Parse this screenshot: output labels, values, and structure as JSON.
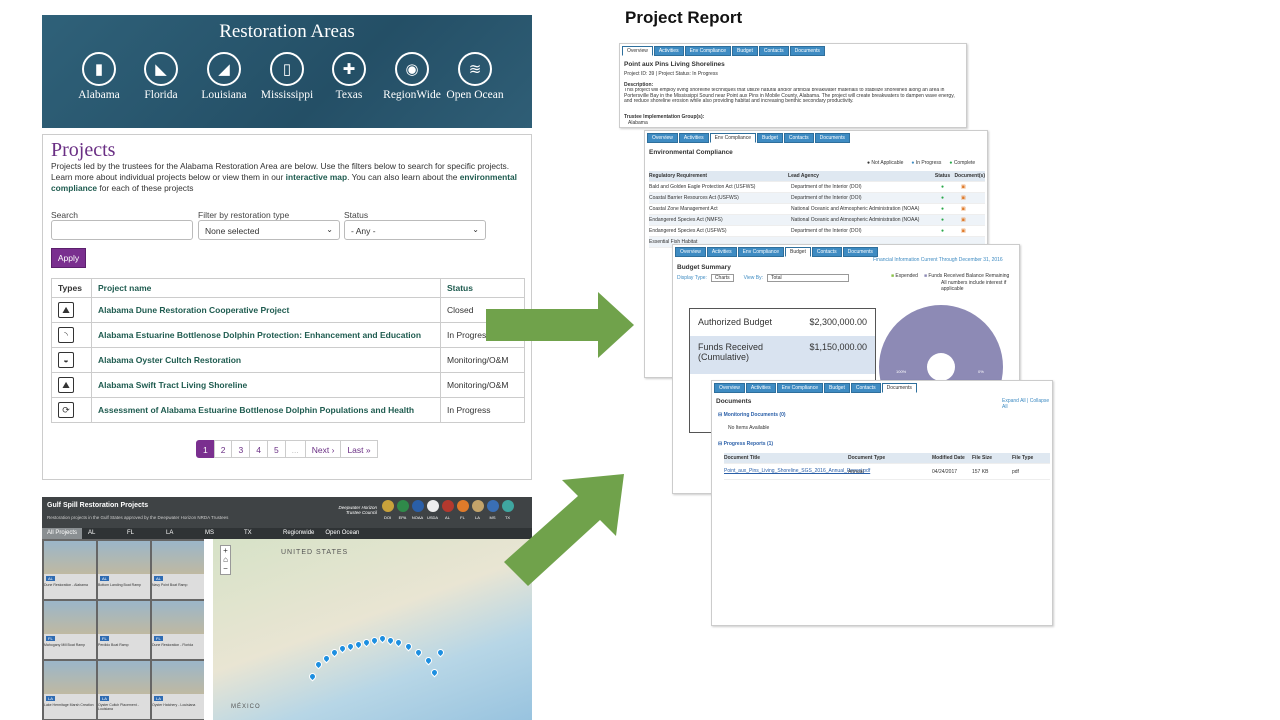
{
  "restoration_areas": {
    "title": "Restoration Areas",
    "areas": [
      {
        "label": "Alabama",
        "icon": "alabama-state-icon"
      },
      {
        "label": "Florida",
        "icon": "florida-state-icon"
      },
      {
        "label": "Louisiana",
        "icon": "louisiana-state-icon"
      },
      {
        "label": "Mississippi",
        "icon": "mississippi-state-icon"
      },
      {
        "label": "Texas",
        "icon": "texas-state-icon"
      },
      {
        "label": "RegionWide",
        "icon": "region-wide-icon"
      },
      {
        "label": "Open Ocean",
        "icon": "open-ocean-icon"
      }
    ]
  },
  "projects": {
    "title": "Projects",
    "desc_1": "Projects led by the trustees for the Alabama Restoration Area are below. Use the filters below to search for specific projects. Learn more about individual projects below or view them in our ",
    "link_map": "interactive map",
    "desc_2": ". You can also learn about the ",
    "link_env": "environmental compliance",
    "desc_3": " for each of these projects",
    "search_label": "Search",
    "search_value": "",
    "type_label": "Filter by restoration type",
    "type_value": "None selected",
    "status_label": "Status",
    "status_value": "- Any -",
    "apply": "Apply",
    "columns": {
      "types": "Types",
      "name": "Project name",
      "status": "Status"
    },
    "rows": [
      {
        "icon": "dune-restoration-icon",
        "name": "Alabama Dune Restoration Cooperative Project",
        "status": "Closed"
      },
      {
        "icon": "dolphin-icon",
        "name": "Alabama Estuarine Bottlenose Dolphin Protection: Enhancement and Education",
        "status": "In Progress"
      },
      {
        "icon": "oyster-icon",
        "name": "Alabama Oyster Cultch Restoration",
        "status": "Monitoring/O&M"
      },
      {
        "icon": "shoreline-icon",
        "name": "Alabama Swift Tract Living Shoreline",
        "status": "Monitoring/O&M"
      },
      {
        "icon": "assessment-icon",
        "name": "Assessment of Alabama Estuarine Bottlenose Dolphin Populations and Health",
        "status": "In Progress"
      }
    ],
    "pager": [
      "1",
      "2",
      "3",
      "4",
      "5",
      "...",
      "Next ›",
      "Last »"
    ]
  },
  "map_app": {
    "title": "Gulf Spill Restoration Projects",
    "subtitle": "Restoration projects in the Gulf States approved by the Deepwater Horizon NRDA Trustees",
    "council": "Deepwater Horizon Trustee Council",
    "agencies": [
      "DOI",
      "EPA",
      "NOAA",
      "USDA",
      "AL",
      "FL",
      "LA",
      "MS",
      "TX"
    ],
    "tabs": [
      "All Projects",
      "AL",
      "FL",
      "LA",
      "MS",
      "TX",
      "Regionwide",
      "Open Ocean"
    ],
    "thumbs": [
      {
        "tag": "AL",
        "label": "Dune Restoration - Alabama"
      },
      {
        "tag": "AL",
        "label": "Bottom Landing Boat Ramp"
      },
      {
        "tag": "AL",
        "label": "Navy Point Boat Ramp"
      },
      {
        "tag": "FL",
        "label": "Mahogany Mill Boat Ramp"
      },
      {
        "tag": "FL",
        "label": "Perdido Boat Ramp"
      },
      {
        "tag": "FL",
        "label": "Dune Restoration - Florida"
      },
      {
        "tag": "LA",
        "label": "Lake Hermitage Marsh Creation"
      },
      {
        "tag": "LA",
        "label": "Oyster Cultch Placement - Louisiana"
      },
      {
        "tag": "LA",
        "label": "Oyster Hatchery - Louisiana"
      }
    ],
    "map_labels": {
      "us": "UNITED STATES",
      "mx": "MÉXICO"
    },
    "zoom_in": "+",
    "zoom_out": "−"
  },
  "report": {
    "title": "Project Report",
    "tabs": [
      "Overview",
      "Activities",
      "Env Compliance",
      "Budget",
      "Contacts",
      "Documents"
    ],
    "overview": {
      "name": "Point aux Pins Living Shorelines",
      "id_line": "Project ID: 39 | Project Status: In Progress",
      "desc_label": "Description:",
      "desc": "This project will employ living shoreline techniques that utilize natural and/or artificial breakwater materials to stabilize shorelines along an area in Portersville Bay in the Mississippi Sound near Point aux Pins in Mobile County, Alabama. The project will create breakwaters to dampen wave energy, and reduce shoreline erosion while also providing habitat and increasing benthic secondary productivity.",
      "tig_label": "Trustee Implementation Group(s):",
      "tig": "Alabama"
    },
    "env": {
      "title": "Environmental Compliance",
      "legend": [
        "Not Applicable",
        "In Progress",
        "Complete"
      ],
      "cols": [
        "Regulatory Requirement",
        "Lead Agency",
        "Status",
        "Document(s)"
      ],
      "rows": [
        [
          "Bald and Golden Eagle Protection Act (USFWS)",
          "Department of the Interior (DOI)"
        ],
        [
          "Coastal Barrier Resources Act (USFWS)",
          "Department of the Interior (DOI)"
        ],
        [
          "Coastal Zone Management Act",
          "National Oceanic and Atmospheric Administration (NOAA)"
        ],
        [
          "Endangered Species Act (NMFS)",
          "National Oceanic and Atmospheric Administration (NOAA)"
        ],
        [
          "Endangered Species Act (USFWS)",
          "Department of the Interior (DOI)"
        ],
        [
          "Essential Fish Habitat",
          ""
        ]
      ]
    },
    "budget": {
      "title": "Budget Summary",
      "note": "Financial Information Current Through December 31, 2016",
      "display_label": "Display Type:",
      "display_value": "Charts",
      "view_label": "View By:",
      "view_value": "Total",
      "legend": [
        "Expended",
        "Funds Received Balance Remaining"
      ],
      "legend_note": "All numbers include interest if applicable",
      "rows": [
        {
          "label": "Authorized Budget",
          "value": "$2,300,000.00"
        },
        {
          "label": "Funds Received (Cumulative)",
          "value": "$1,150,000.00"
        }
      ],
      "pie": {
        "Expended": 0,
        "Funds Received Balance Remaining": 100
      },
      "pie_labels": [
        "100%",
        "0%"
      ]
    },
    "docs": {
      "title": "Documents",
      "links": "Expand All | Collapse All",
      "monitor": "Monitoring Documents (0)",
      "no_items": "No Items Available",
      "progress": "Progress Reports (1)",
      "cols": [
        "Document Title",
        "Document Type",
        "Modified Date",
        "File Size",
        "File Type"
      ],
      "row": [
        "Point_aux_Pins_Living_Shoreline_SGS_2016_Annual_Report.pdf",
        "Annual",
        "04/24/2017",
        "157 KB",
        "pdf"
      ]
    }
  },
  "colors": {
    "accent": "#7a2f8f",
    "teal": "#1e5b4f",
    "arrow": "#70a24b",
    "tab": "#3e8bc2"
  }
}
